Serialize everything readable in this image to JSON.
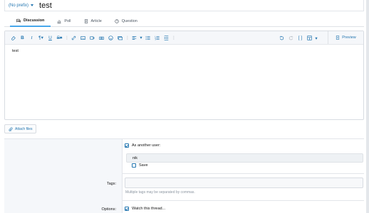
{
  "title_row": {
    "prefix": "(No prefix)",
    "title": "test"
  },
  "tabs": [
    {
      "label": "Discussion",
      "icon": "discussion-icon",
      "active": true
    },
    {
      "label": "Poll",
      "icon": "poll-icon"
    },
    {
      "label": "Article",
      "icon": "article-icon"
    },
    {
      "label": "Question",
      "icon": "question-icon"
    }
  ],
  "editor": {
    "preview_label": "Preview",
    "content": "test"
  },
  "attach_label": "Attach files",
  "form": {
    "as_another_user_label": "As another user:",
    "user_value": "nik",
    "save_label": "Save",
    "tags_label": "Tags:",
    "tags_hint": "Multiple tags may be separated by commas.",
    "options_label": "Options:",
    "watch_label": "Watch this thread..."
  },
  "colors": {
    "accent": "#2577b1",
    "tab_underline": "#47a7eb"
  }
}
